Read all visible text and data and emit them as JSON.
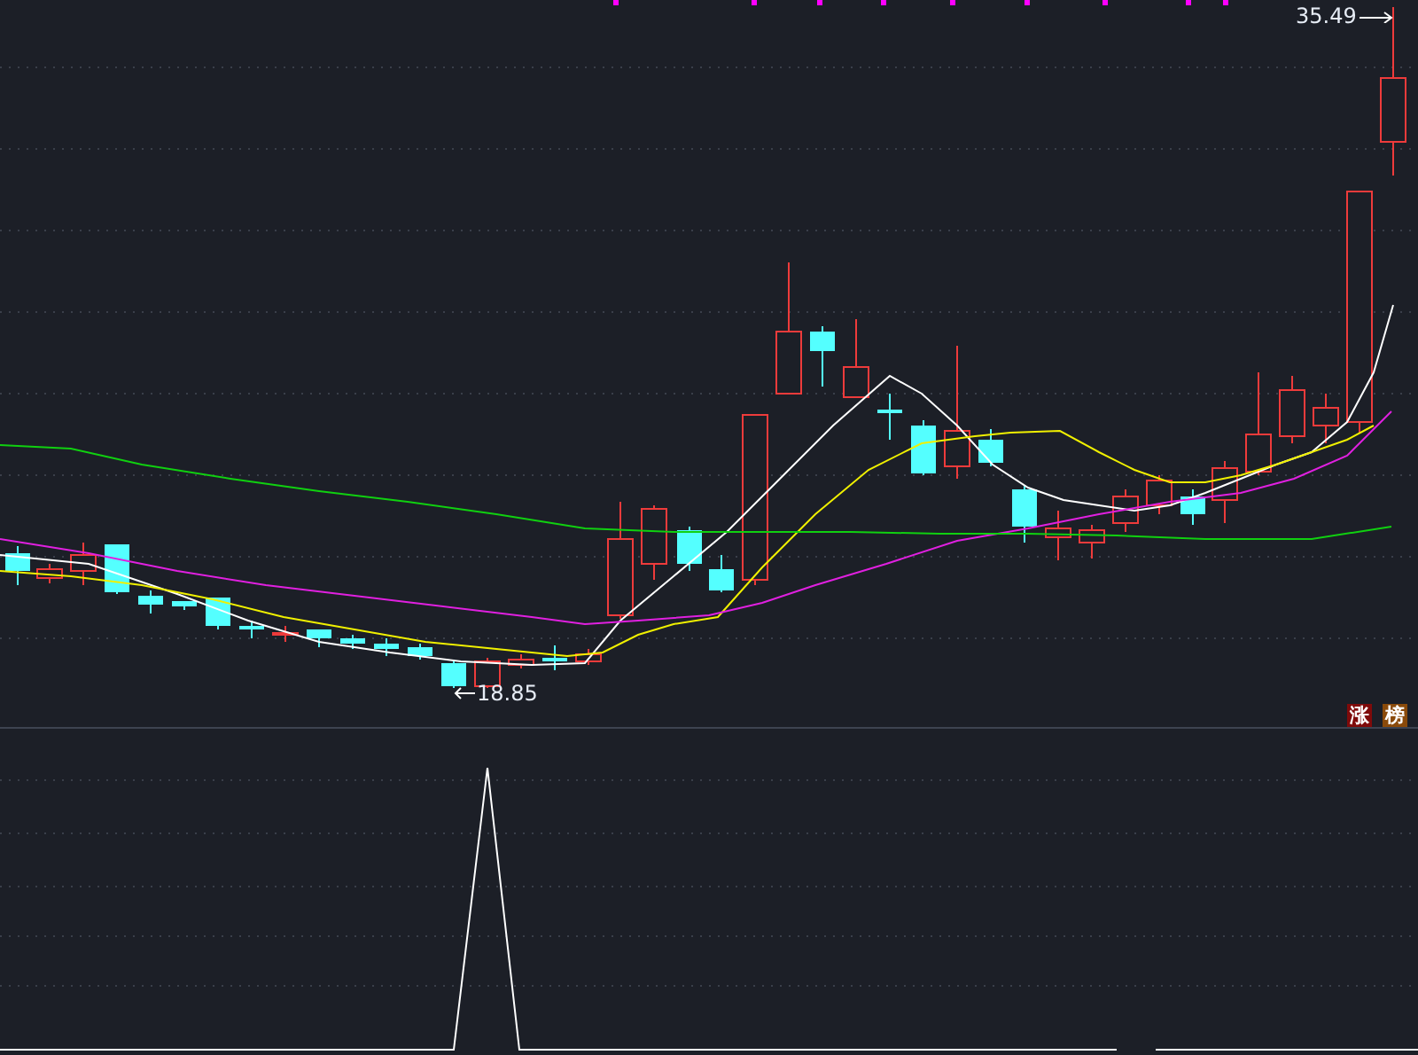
{
  "price_labels": {
    "high": "35.49",
    "low": "18.85"
  },
  "badges": [
    {
      "text": "涨",
      "color": "#7f0a0a"
    },
    {
      "text": "榜",
      "color": "#8a4a0a"
    }
  ]
}
